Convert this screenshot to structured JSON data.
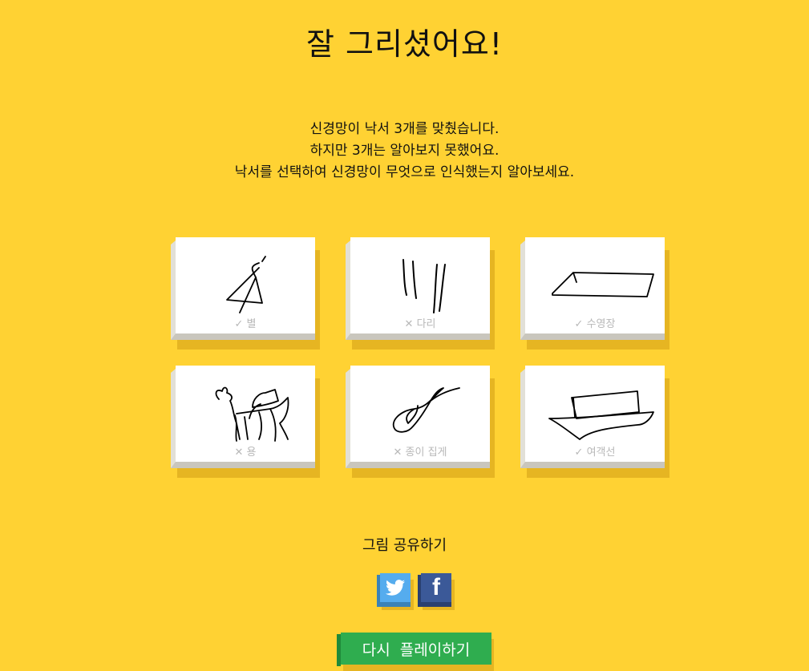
{
  "title": "잘 그리셨어요!",
  "message": {
    "line1": "신경망이 낙서 3개를 맞췄습니다.",
    "line2": "하지만 3개는 알아보지 못했어요.",
    "line3": "낙서를 선택하여 신경망이 무엇으로 인식했는지 알아보세요."
  },
  "drawings": [
    {
      "mark": "✓",
      "label": "별",
      "recognized": true
    },
    {
      "mark": "✕",
      "label": "다리",
      "recognized": false
    },
    {
      "mark": "✓",
      "label": "수영장",
      "recognized": true
    },
    {
      "mark": "✕",
      "label": "용",
      "recognized": false
    },
    {
      "mark": "✕",
      "label": "종이 집게",
      "recognized": false
    },
    {
      "mark": "✓",
      "label": "여객선",
      "recognized": true
    }
  ],
  "share": {
    "label": "그림 공유하기",
    "twitter_icon": "twitter-icon",
    "facebook_icon": "facebook-icon",
    "facebook_glyph": "f"
  },
  "replay_label": "다시  플레이하기",
  "colors": {
    "background": "#ffd233",
    "twitter": "#55acee",
    "facebook": "#3b5998",
    "replay": "#2fad4f"
  }
}
